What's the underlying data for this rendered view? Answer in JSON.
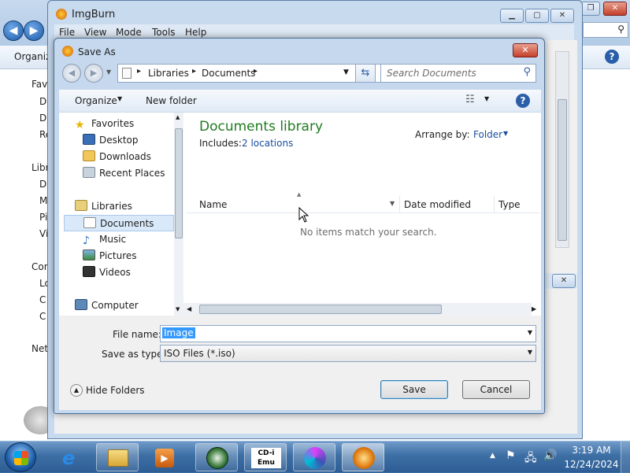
{
  "background_explorer": {
    "toolbar_organize": "Organiz",
    "nav_items": [
      "Favo",
      "D",
      "D",
      "Re",
      "Libr",
      "D",
      "M",
      "Pi",
      "Vi",
      "Con",
      "Lo",
      "C",
      "C",
      "Net"
    ]
  },
  "imgburn": {
    "title": "ImgBurn",
    "menu": [
      "File",
      "View",
      "Mode",
      "Tools",
      "Help"
    ]
  },
  "dialog": {
    "title": "Save As",
    "breadcrumb": [
      "Libraries",
      "Documents"
    ],
    "search_placeholder": "Search Documents",
    "organize_label": "Organize",
    "new_folder_label": "New folder",
    "nav": {
      "favorites": "Favorites",
      "desktop": "Desktop",
      "downloads": "Downloads",
      "recent_places": "Recent Places",
      "libraries": "Libraries",
      "documents": "Documents",
      "music": "Music",
      "pictures": "Pictures",
      "videos": "Videos",
      "computer": "Computer"
    },
    "library_title": "Documents library",
    "includes_label": "Includes:",
    "includes_link": "2 locations",
    "arrange_by_label": "Arrange by:",
    "arrange_by_value": "Folder",
    "columns": [
      "Name",
      "Date modified",
      "Type"
    ],
    "empty_message": "No items match your search.",
    "file_name_label": "File name:",
    "file_name_value": "Image",
    "save_as_type_label": "Save as type:",
    "save_as_type_value": "ISO Files (*.iso)",
    "hide_folders_label": "Hide Folders",
    "save_label": "Save",
    "cancel_label": "Cancel"
  },
  "taskbar": {
    "time": "3:19 AM",
    "date": "12/24/2024",
    "cdemu_label": "CD-i Emu"
  },
  "colors": {
    "library_title": "#1e7b1e",
    "link": "#1a4fa0",
    "selection": "#3399ff",
    "taskbar": "#3d6fa5"
  }
}
